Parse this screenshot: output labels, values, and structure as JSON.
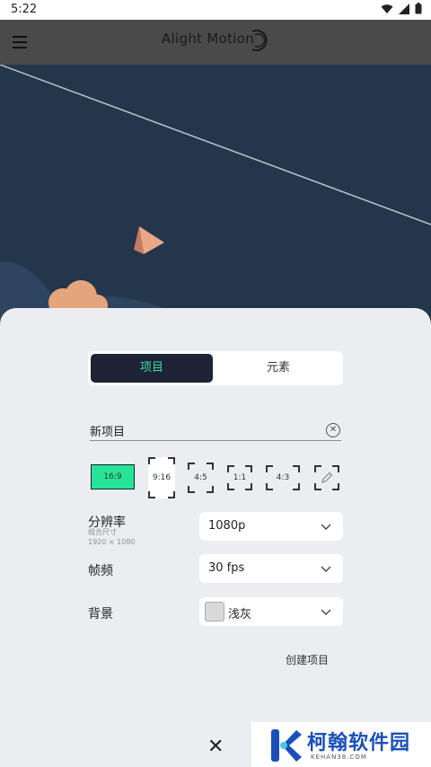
{
  "status": {
    "time": "5:22"
  },
  "appbar": {
    "title": "Alight Motion"
  },
  "sheet": {
    "tabs": [
      {
        "label": "项目"
      },
      {
        "label": "元素"
      }
    ],
    "project_name": {
      "value": "新项目",
      "placeholder": ""
    },
    "ratios": [
      "16:9",
      "9:16",
      "4:5",
      "1:1",
      "4:3"
    ],
    "selected_ratio": "16:9",
    "resolution": {
      "label": "分辨率",
      "sub1": "组合尺寸",
      "sub2": "1920 × 1080",
      "value": "1080p"
    },
    "framerate": {
      "label": "帧频",
      "value": "30 fps"
    },
    "background": {
      "label": "背景",
      "value": "浅灰",
      "color": "#d9d9d9"
    },
    "create_label": "创建项目"
  },
  "watermark": {
    "brand": "柯翰软件园",
    "url": "KEHAN38.COM"
  },
  "colors": {
    "accent": "#27e397",
    "tab_active_bg": "#1e2336",
    "tab_active_text": "#36e0a6",
    "canvas": "#24364a"
  }
}
